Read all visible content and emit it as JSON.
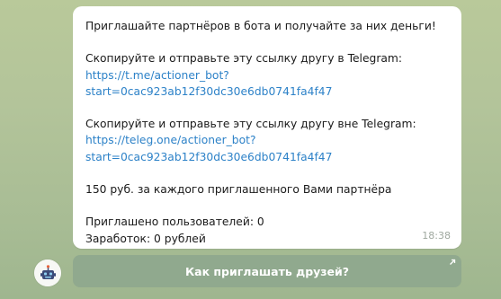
{
  "message": {
    "heading": "Приглашайте партнёров в бота и получайте за них деньги!",
    "inside_label": "Скопируйте и отправьте эту ссылку другу в Telegram:",
    "inside_link_line1": "https://t.me/actioner_bot?",
    "inside_link_line2": "start=0cac923ab12f30dc30e6db0741fa4f47",
    "outside_label": "Скопируйте и отправьте эту ссылку другу вне Telegram:",
    "outside_link_line1": "https://teleg.one/actioner_bot?",
    "outside_link_line2": "start=0cac923ab12f30dc30e6db0741fa4f47",
    "reward": "150 руб. за каждого приглашенного Вами партнёра",
    "invited": "Приглашено пользователей: 0",
    "earned": "Заработок: 0 рублей",
    "time": "18:38"
  },
  "keyboard": {
    "button_label": "Как приглашать друзей?",
    "button_icon": "external-arrow-icon"
  },
  "avatar": {
    "icon": "bot-avatar-icon"
  },
  "colors": {
    "link": "#2d82c8",
    "bubble": "#ffffff",
    "keyboard_button": "#90a98e",
    "timestamp": "#a0a9a0"
  }
}
